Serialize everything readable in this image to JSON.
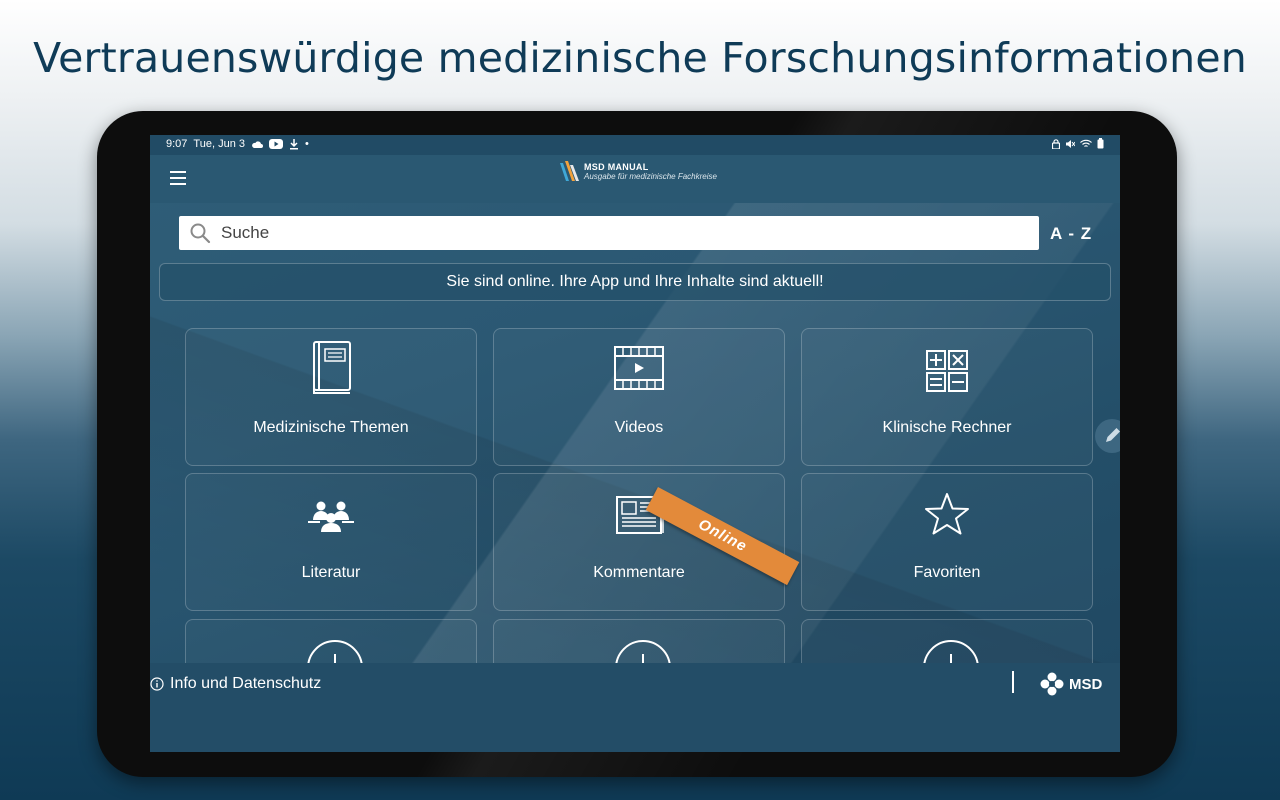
{
  "headline": "Vertrauenswürdige medizinische Forschungsinformationen",
  "status_bar": {
    "time": "9:07",
    "date": "Tue, Jun 3",
    "dot": "•"
  },
  "app_bar": {
    "logo_title": "MSD MANUAL",
    "logo_subtitle": "Ausgabe für medizinische Fachkreise"
  },
  "search": {
    "placeholder": "Suche",
    "az_label": "A - Z"
  },
  "online_banner": "Sie sind online. Ihre App und Ihre Inhalte sind aktuell!",
  "tiles": [
    {
      "label": "Medizinische Themen",
      "icon": "book-icon"
    },
    {
      "label": "Videos",
      "icon": "film-icon"
    },
    {
      "label": "Klinische Rechner",
      "icon": "calculator-icon"
    },
    {
      "label": "Literatur",
      "icon": "people-icon"
    },
    {
      "label": "Kommentare",
      "icon": "newspaper-icon",
      "badge": "Online"
    },
    {
      "label": "Favoriten",
      "icon": "star-icon"
    }
  ],
  "add_tiles_icon": "plus-circle-icon",
  "footer": {
    "info_label": "Info und Datenschutz",
    "brand": "MSD"
  },
  "colors": {
    "headline": "#0f3b57",
    "screen_bg": "#2b5873",
    "ribbon": "#e38a3a",
    "tile_border": "rgba(255,255,255,0.22)"
  }
}
